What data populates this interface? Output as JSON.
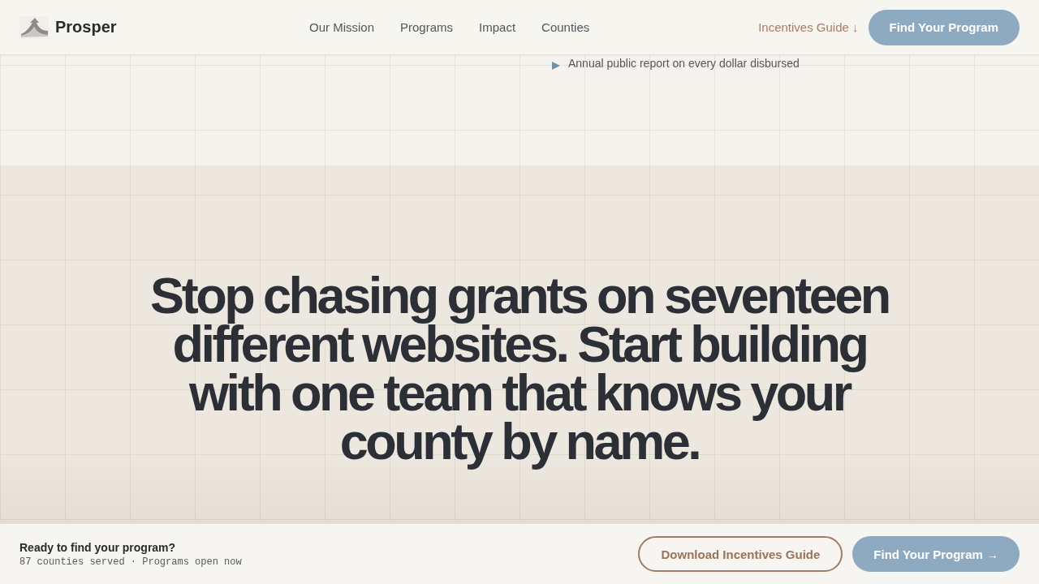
{
  "header": {
    "brand": "Prosper",
    "nav": [
      "Our Mission",
      "Programs",
      "Impact",
      "Counties"
    ],
    "guide_link": "Incentives Guide ↓",
    "cta": "Find Your Program"
  },
  "notes": [
    "Annual public report on every dollar disbursed"
  ],
  "hero": {
    "headline": "Stop chasing grants on seventeen different websites. Start building with one team that knows your county by name."
  },
  "footer_bar": {
    "title": "Ready to find your program?",
    "subtitle": "87 counties served · Programs open now",
    "buttons": [
      {
        "label": "Download Incentives Guide",
        "kind": "outline"
      },
      {
        "label": "Find Your Program →",
        "kind": "primary"
      }
    ]
  }
}
